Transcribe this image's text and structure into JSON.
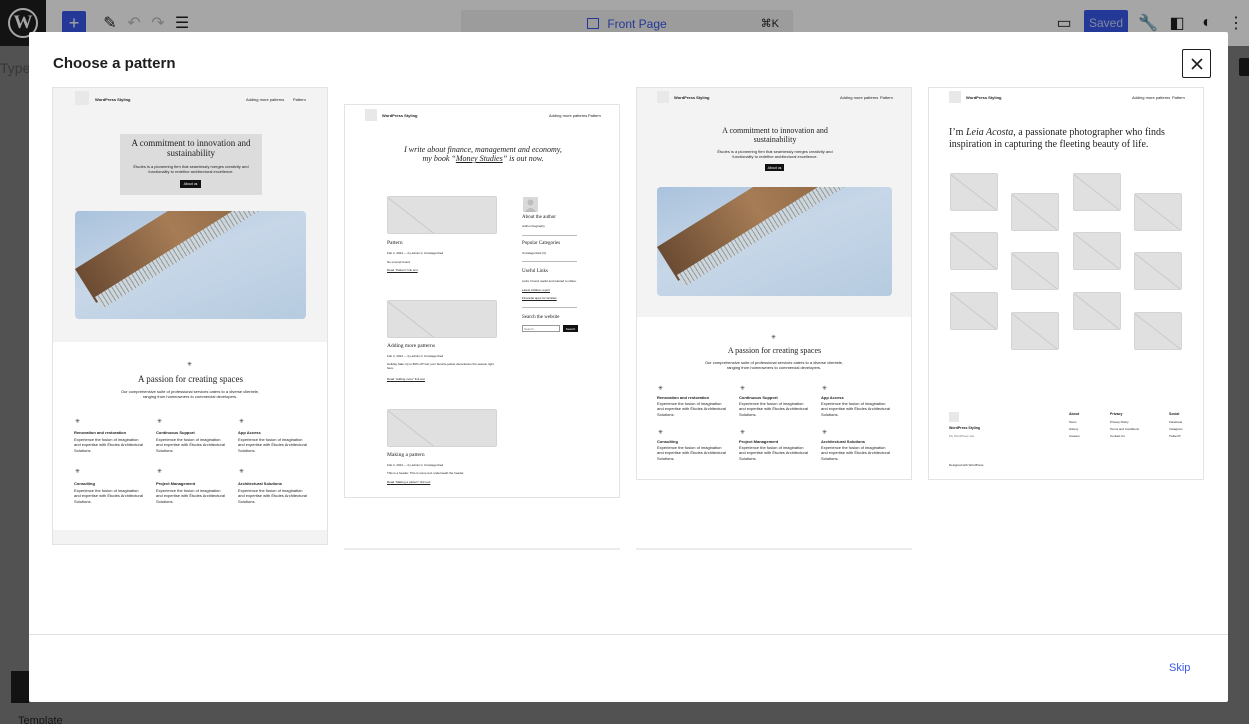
{
  "editor": {
    "document_title": "Front Page",
    "shortcut": "⌘K",
    "saved_label": "Saved",
    "background_type_text": "Type",
    "background_template_text": "Template"
  },
  "modal": {
    "title": "Choose a pattern",
    "skip_label": "Skip"
  },
  "patterns": {
    "p1": {
      "site_title": "WordPress Styling",
      "nav": [
        "Adding more patterns",
        "Pattern"
      ],
      "hero_heading": "A commitment to innovation and sustainability",
      "hero_body": "Études is a pioneering firm that seamlessly merges creativity and functionality to redefine architectural excellence.",
      "hero_button": "About us",
      "section_heading": "A passion for creating spaces",
      "section_body": "Our comprehensive suite of professional services caters to a diverse clientele, ranging from homeowners to commercial developers.",
      "services": [
        {
          "title": "Renovation and restoration",
          "body": "Experience the fusion of imagination and expertise with Études Architectural Solutions."
        },
        {
          "title": "Continuous Support",
          "body": "Experience the fusion of imagination and expertise with Études Architectural Solutions."
        },
        {
          "title": "App Access",
          "body": "Experience the fusion of imagination and expertise with Études Architectural Solutions."
        },
        {
          "title": "Consulting",
          "body": "Experience the fusion of imagination and expertise with Études Architectural Solutions."
        },
        {
          "title": "Project Management",
          "body": "Experience the fusion of imagination and expertise with Études Architectural Solutions."
        },
        {
          "title": "Architectural Solutions",
          "body": "Experience the fusion of imagination and expertise with Études Architectural Solutions."
        }
      ]
    },
    "p2": {
      "site_title": "WordPress Styling",
      "nav": [
        "Adding more patterns",
        "Pattern"
      ],
      "intro_line1": "I write about finance, management and economy,",
      "intro_line2_pre": "my book “",
      "intro_book": "Money Studies",
      "intro_line2_post": "” is out now.",
      "posts": [
        {
          "title": "Pattern",
          "meta": "Feb 2, 2024 — by admin in Uncategorized",
          "excerpt": "No excerpt found",
          "more": "Read “Pattern” link text"
        },
        {
          "title": "Adding more patterns",
          "meta": "Feb 2, 2024 — by admin in Uncategorized",
          "excerpt": "Holiday Sale Up to 80% off! Get your favorite jacket decorations the season right here.",
          "more": "Read “Adding more” link text"
        },
        {
          "title": "Making a pattern",
          "meta": "Feb 2, 2024 — by admin in Uncategorized",
          "excerpt": "This is a header. This is some text underneath the header.",
          "more": "Read “Making a pattern” link text"
        }
      ],
      "sidebar": {
        "about_heading": "About the author",
        "about_body": "Author biography",
        "categories_heading": "Popular Categories",
        "categories_body": "Uncategorized (3)",
        "links_heading": "Useful Links",
        "links_body": "Links I found useful and wanted to share.",
        "link1": "Latest inflation report",
        "link2": "Financial apps for families",
        "search_heading": "Search the website",
        "search_placeholder": "Search...",
        "search_button": "Search"
      }
    },
    "p3": {
      "site_title": "WordPress Styling",
      "nav": [
        "Adding more patterns",
        "Pattern"
      ],
      "hero_heading": "A commitment to innovation and sustainability",
      "hero_body": "Études is a pioneering firm that seamlessly merges creativity and functionality to redefine architectural excellence.",
      "hero_button": "About us",
      "section_heading": "A passion for creating spaces",
      "section_body": "Our comprehensive suite of professional services caters to a diverse clientele, ranging from homeowners to commercial developers.",
      "services": [
        {
          "title": "Renovation and restoration",
          "body": "Experience the fusion of imagination and expertise with Études Architectural Solutions."
        },
        {
          "title": "Continuous Support",
          "body": "Experience the fusion of imagination and expertise with Études Architectural Solutions."
        },
        {
          "title": "App Access",
          "body": "Experience the fusion of imagination and expertise with Études Architectural Solutions."
        },
        {
          "title": "Consulting",
          "body": "Experience the fusion of imagination and expertise with Études Architectural Solutions."
        },
        {
          "title": "Project Management",
          "body": "Experience the fusion of imagination and expertise with Études Architectural Solutions."
        },
        {
          "title": "Architectural Solutions",
          "body": "Experience the fusion of imagination and expertise with Études Architectural Solutions."
        }
      ]
    },
    "p4": {
      "site_title": "WordPress Styling",
      "nav": [
        "Adding more patterns",
        "Pattern"
      ],
      "intro_pre": "I’m ",
      "intro_name": "Leia Acosta",
      "intro_post": ", a passionate photographer who finds inspiration in capturing the fleeting beauty of life.",
      "footer_site": "WordPress Styling",
      "footer_tagline": "My WordPress site",
      "footer_cols": [
        {
          "heading": "About",
          "items": [
            "Team",
            "History",
            "Careers"
          ]
        },
        {
          "heading": "Privacy",
          "items": [
            "Privacy Policy",
            "Terms and Conditions",
            "Contact Us"
          ]
        },
        {
          "heading": "Social",
          "items": [
            "Facebook",
            "Instagram",
            "Twitter/X"
          ]
        }
      ],
      "designed_with": "Designed with WordPress"
    }
  },
  "colors": {
    "accent": "#3858e9",
    "overlay": "rgba(0,0,0,0.35)"
  }
}
